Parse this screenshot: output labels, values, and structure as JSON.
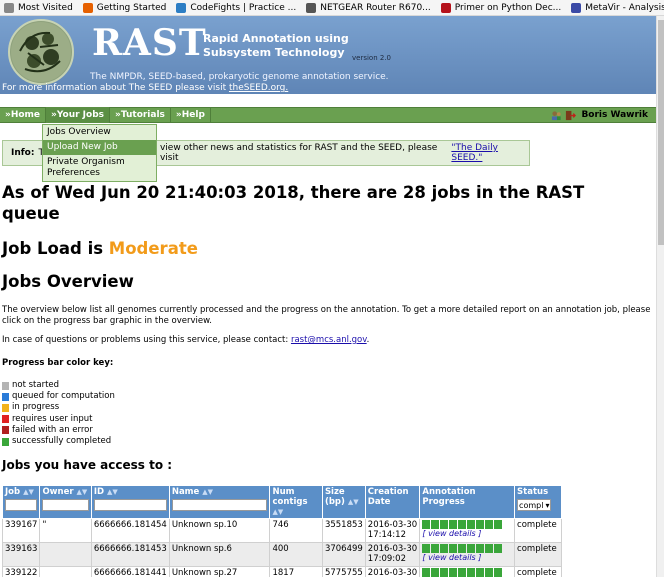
{
  "bookmarks": [
    {
      "label": "Most Visited",
      "icon": "gear-icon",
      "color": "#888888"
    },
    {
      "label": "Getting Started",
      "icon": "firefox-icon",
      "color": "#e66000"
    },
    {
      "label": "CodeFights | Practice ...",
      "icon": "codefights-icon",
      "color": "#2d7ec4"
    },
    {
      "label": "NETGEAR Router R670...",
      "icon": "globe-icon",
      "color": "#555555"
    },
    {
      "label": "Primer on Python Dec...",
      "icon": "rp-icon",
      "color": "#b5121b"
    },
    {
      "label": "MetaVir - Analysis of v...",
      "icon": "mv-icon",
      "color": "#3b4aa6"
    }
  ],
  "header": {
    "title": "RAST",
    "subtitle_line1": "Rapid Annotation using",
    "subtitle_line2": "Subsystem Technology",
    "version": "version 2.0",
    "description": "The NMPDR, SEED-based, prokaryotic genome annotation service.",
    "more_info_prefix": "For more information about The SEED please visit",
    "more_info_link": "theSEED.org."
  },
  "nav": {
    "items": [
      "»Home",
      "»Your Jobs",
      "»Tutorials",
      "»Help"
    ],
    "active": "»Your Jobs",
    "user_name": "Boris Wawrik"
  },
  "dropdown": {
    "items": [
      "Jobs Overview",
      "Upload New Job",
      "Private Organism Preferences"
    ],
    "hovered": "Upload New Job"
  },
  "info": {
    "label": "Info:",
    "text_before": "T",
    "text_visible": "view other news and statistics for RAST and the SEED, please visit",
    "link": "\"The Daily SEED.\""
  },
  "content": {
    "queue_heading": "As of Wed Jun 20 21:40:03 2018, there are 28 jobs in the RAST queue",
    "load_prefix": "Job Load is",
    "load_value": "Moderate",
    "overview_heading": "Jobs Overview",
    "overview_text": "The overview below list all genomes currently processed and the progress on the annotation. To get a more detailed report on an annotation job, please click on the progress bar graphic in the overview.",
    "contact_prefix": "In case of questions or problems using this service, please contact:",
    "contact_email": "rast@mcs.anl.gov",
    "contact_suffix": ".",
    "key_title": "Progress bar color key:",
    "key": [
      {
        "label": "not started",
        "color": "#b4b4b4"
      },
      {
        "label": "queued for computation",
        "color": "#2a7bd8"
      },
      {
        "label": "in progress",
        "color": "#f2b21b"
      },
      {
        "label": "requires user input",
        "color": "#e02222"
      },
      {
        "label": "failed with an error",
        "color": "#b02020"
      },
      {
        "label": "successfully completed",
        "color": "#3aa63a"
      }
    ],
    "access_heading": "Jobs you have access to :"
  },
  "jobs_table": {
    "headers": [
      "Job",
      "Owner",
      "ID",
      "Name",
      "Num contigs",
      "Size (bp)",
      "Creation Date",
      "Annotation Progress",
      "Status"
    ],
    "status_filter": "compl",
    "details_label": "[ view details ]",
    "rows": [
      {
        "job": "339167",
        "owner": "\"",
        "id": "6666666.181454",
        "name": "Unknown sp.10",
        "contigs": "746",
        "size": "3551853",
        "date": "2016-03-30 17:14:12",
        "status": "complete"
      },
      {
        "job": "339163",
        "owner": "",
        "id": "6666666.181453",
        "name": "Unknown sp.6",
        "contigs": "400",
        "size": "3706499",
        "date": "2016-03-30 17:09:02",
        "status": "complete"
      },
      {
        "job": "339122",
        "owner": "",
        "id": "6666666.181441",
        "name": "Unknown sp.27",
        "contigs": "1817",
        "size": "5775755",
        "date": "2016-03-30",
        "status": "complete"
      }
    ]
  }
}
